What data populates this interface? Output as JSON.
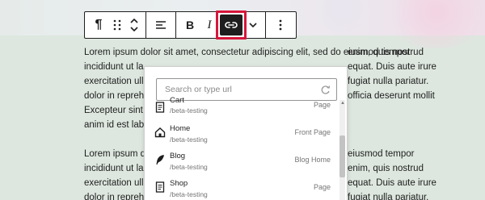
{
  "colors": {
    "page_bg": "#dde7df",
    "text": "#1e1e1e",
    "highlight": "#d6153b",
    "muted": "#757575"
  },
  "toolbar": {
    "items": [
      {
        "name": "paragraph-icon",
        "glyph": "¶"
      },
      {
        "name": "drag-handle-icon",
        "glyph": "⠿"
      },
      {
        "name": "move-up-down-icon",
        "glyph": "⌃⌄"
      },
      {
        "name": "align-icon",
        "glyph": "≡"
      },
      {
        "name": "bold-button",
        "label": "B"
      },
      {
        "name": "italic-button",
        "label": "I"
      },
      {
        "name": "link-icon",
        "glyph": "🔗",
        "active": true
      },
      {
        "name": "more-chevron-icon",
        "glyph": "⌄"
      },
      {
        "name": "options-icon",
        "glyph": "⋮"
      }
    ]
  },
  "content": {
    "para1": [
      "Lorem ipsum dolor sit amet, consectetur adipiscing elit, sed do eiusmod tempor",
      "incididunt ut la",
      "exercitation ulla",
      "dolor in repreh",
      "Excepteur sint o",
      "anim id est labo"
    ],
    "para1_right": [
      "",
      "enim, quis nostrud",
      "equat. Duis aute irure",
      "fugiat nulla pariatur.",
      "officia deserunt mollit",
      ""
    ],
    "para2": [
      "Lorem ipsum do",
      "incididunt ut la",
      "exercitation ulla",
      "dolor in repreh"
    ],
    "para2_right": [
      "eiusmod tempor",
      "enim, quis nostrud",
      "equat. Duis aute irure",
      "fugiat nulla pariatur."
    ]
  },
  "link_popover": {
    "search_placeholder": "Search or type url",
    "results": [
      {
        "title": "Cart",
        "path": "/beta-testing",
        "type": "Page",
        "icon": "page-icon"
      },
      {
        "title": "Home",
        "path": "/beta-testing",
        "type": "Front Page",
        "icon": "home-icon"
      },
      {
        "title": "Blog",
        "path": "/beta-testing",
        "type": "Blog Home",
        "icon": "feather-icon"
      },
      {
        "title": "Shop",
        "path": "/beta-testing",
        "type": "Page",
        "icon": "page-icon"
      }
    ]
  }
}
